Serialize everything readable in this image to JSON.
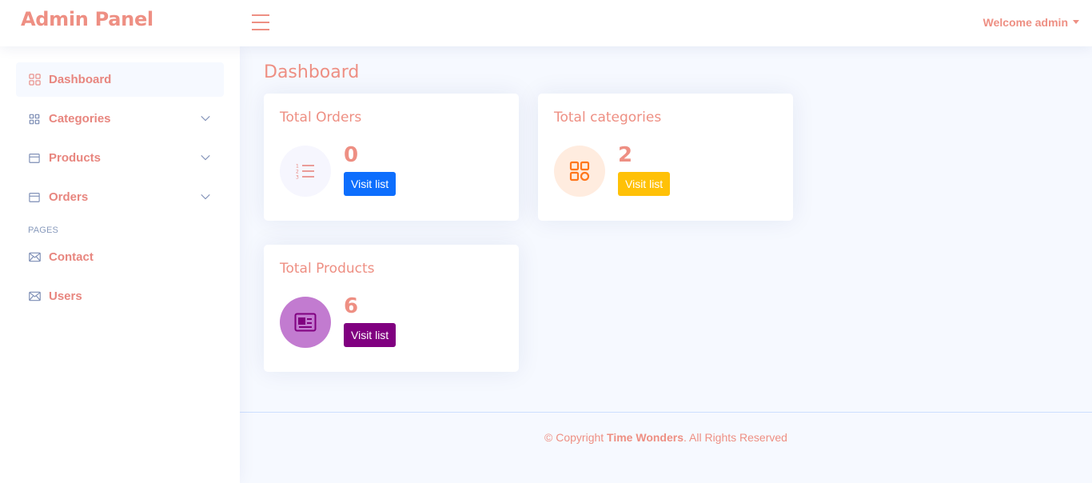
{
  "header": {
    "brand": "Admin Panel",
    "welcome": "Welcome admin"
  },
  "sidebar": {
    "items": [
      {
        "label": "Dashboard",
        "icon": "grid-icon",
        "active": true
      },
      {
        "label": "Categories",
        "icon": "menu-grid-icon",
        "has_children": true
      },
      {
        "label": "Products",
        "icon": "layout-icon",
        "has_children": true
      },
      {
        "label": "Orders",
        "icon": "layout-icon",
        "has_children": true
      }
    ],
    "pages_heading": "PAGES",
    "pages": [
      {
        "label": "Contact",
        "icon": "envelope-icon"
      },
      {
        "label": "Users",
        "icon": "envelope-icon"
      }
    ]
  },
  "main": {
    "title": "Dashboard",
    "cards": [
      {
        "title": "Total Orders",
        "value": "0",
        "button": "Visit list",
        "icon": "list-ol-icon",
        "icon_bg": "#f6f6fe",
        "icon_color": "#e8867f",
        "button_color": "#0d6efd"
      },
      {
        "title": "Total categories",
        "value": "2",
        "button": "Visit list",
        "icon": "grid-icon",
        "icon_bg": "#ffecdf",
        "icon_color": "#ff771d",
        "button_color": "#ffc107"
      },
      {
        "title": "Total Products",
        "value": "6",
        "button": "Visit list",
        "icon": "newspaper-icon",
        "icon_bg": "#c27bd0",
        "icon_color": "#800080",
        "button_color": "#800080"
      }
    ]
  },
  "footer": {
    "prefix": "© Copyright ",
    "company": "Time Wonders",
    "suffix": ". All Rights Reserved"
  }
}
